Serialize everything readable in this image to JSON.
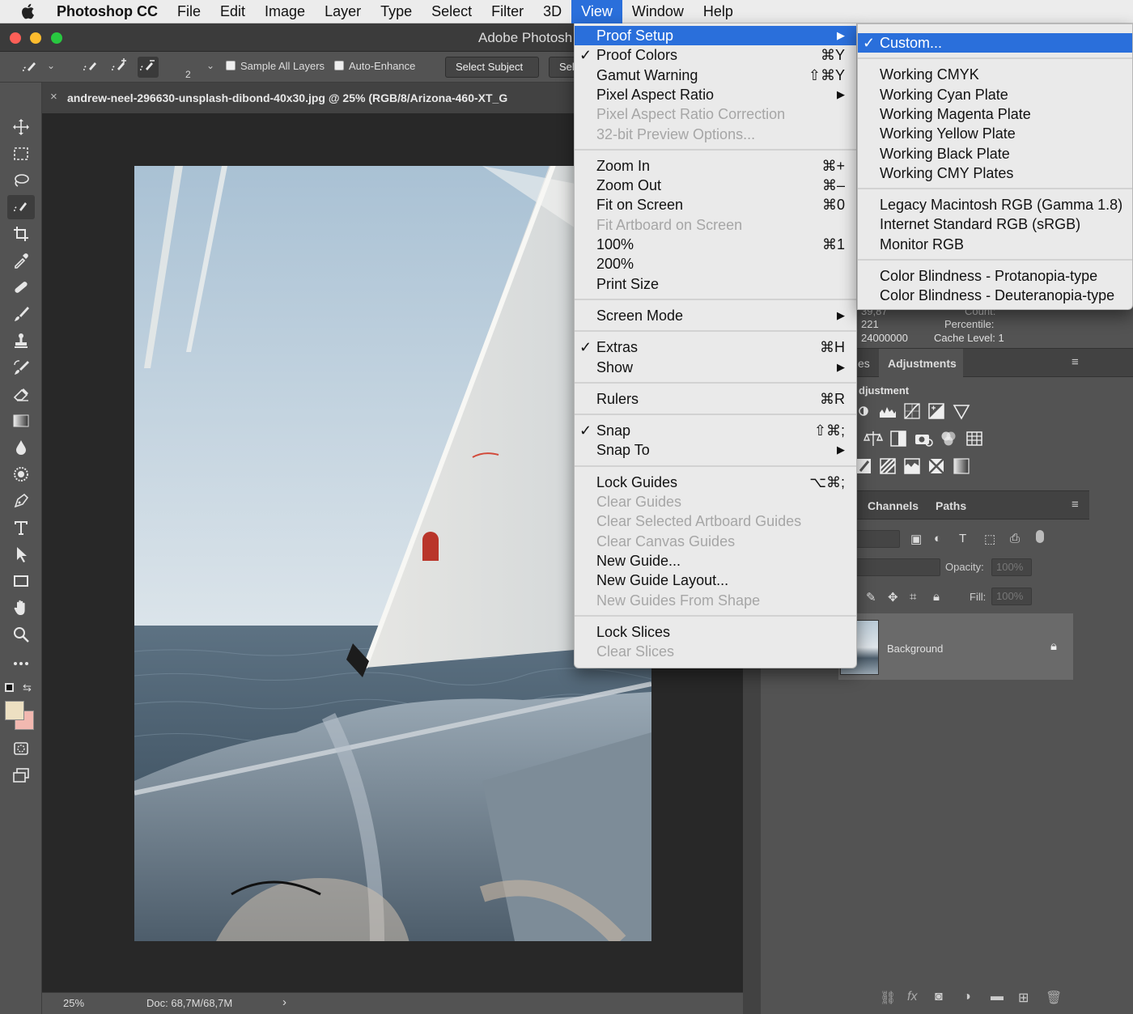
{
  "menubar": {
    "app_name": "Photoshop CC",
    "items": [
      "File",
      "Edit",
      "Image",
      "Layer",
      "Type",
      "Select",
      "Filter",
      "3D",
      "View",
      "Window",
      "Help"
    ],
    "active_item": "View"
  },
  "window": {
    "title": "Adobe Photosh",
    "lights": [
      "#fe5f57",
      "#febc2e",
      "#28c840"
    ]
  },
  "options_bar": {
    "brush_size": "2",
    "sample_all_layers": "Sample All Layers",
    "auto_enhance": "Auto-Enhance",
    "select_subject": "Select Subject",
    "select_and_mask_partial": "Sel"
  },
  "document": {
    "tab_close": "×",
    "tab_title": "andrew-neel-296630-unsplash-dibond-40x30.jpg @ 25% (RGB/8/Arizona-460-XT_G"
  },
  "status": {
    "zoom": "25%",
    "doc_size": "Doc: 68,7M/68,7M",
    "arrow": "›"
  },
  "histogram_info": {
    "col1": [
      "39,87",
      "221",
      "24000000"
    ],
    "col2": [
      "Count:",
      "Percentile:",
      "Cache Level:  1"
    ]
  },
  "adjustments": {
    "tab_prev_partial": "es",
    "tab_active": "Adjustments",
    "header_partial": "djustment"
  },
  "layers": {
    "tabs": [
      "Channels",
      "Paths"
    ],
    "opacity_label": "Opacity:",
    "opacity_value": "100%",
    "fill_label": "Fill:",
    "fill_value": "100%",
    "layer_name": "Background"
  },
  "view_menu": {
    "items": [
      {
        "label": "Proof Setup",
        "arrow": "▶",
        "highlight": true
      },
      {
        "label": "Proof Colors",
        "check": "✓",
        "shortcut": "⌘Y"
      },
      {
        "label": "Gamut Warning",
        "shortcut": "⇧⌘Y"
      },
      {
        "label": "Pixel Aspect Ratio",
        "arrow": "▶"
      },
      {
        "label": "Pixel Aspect Ratio Correction",
        "disabled": true
      },
      {
        "label": "32-bit Preview Options...",
        "disabled": true
      },
      {
        "sep": true
      },
      {
        "label": "Zoom In",
        "shortcut": "⌘+"
      },
      {
        "label": "Zoom Out",
        "shortcut": "⌘–"
      },
      {
        "label": "Fit on Screen",
        "shortcut": "⌘0"
      },
      {
        "label": "Fit Artboard on Screen",
        "disabled": true
      },
      {
        "label": "100%",
        "shortcut": "⌘1"
      },
      {
        "label": "200%"
      },
      {
        "label": "Print Size"
      },
      {
        "sep": true
      },
      {
        "label": "Screen Mode",
        "arrow": "▶"
      },
      {
        "sep": true
      },
      {
        "label": "Extras",
        "check": "✓",
        "shortcut": "⌘H"
      },
      {
        "label": "Show",
        "arrow": "▶"
      },
      {
        "sep": true
      },
      {
        "label": "Rulers",
        "shortcut": "⌘R"
      },
      {
        "sep": true
      },
      {
        "label": "Snap",
        "check": "✓",
        "shortcut": "⇧⌘;"
      },
      {
        "label": "Snap To",
        "arrow": "▶"
      },
      {
        "sep": true
      },
      {
        "label": "Lock Guides",
        "shortcut": "⌥⌘;"
      },
      {
        "label": "Clear Guides",
        "disabled": true
      },
      {
        "label": "Clear Selected Artboard Guides",
        "disabled": true
      },
      {
        "label": "Clear Canvas Guides",
        "disabled": true
      },
      {
        "label": "New Guide..."
      },
      {
        "label": "New Guide Layout..."
      },
      {
        "label": "New Guides From Shape",
        "disabled": true
      },
      {
        "sep": true
      },
      {
        "label": "Lock Slices"
      },
      {
        "label": "Clear Slices",
        "disabled": true
      }
    ]
  },
  "proof_setup_submenu": {
    "items": [
      {
        "label": "Custom...",
        "check": "✓",
        "highlight": true
      },
      {
        "sep": true
      },
      {
        "label": "Working CMYK"
      },
      {
        "label": "Working Cyan Plate"
      },
      {
        "label": "Working Magenta Plate"
      },
      {
        "label": "Working Yellow Plate"
      },
      {
        "label": "Working Black Plate"
      },
      {
        "label": "Working CMY Plates"
      },
      {
        "sep": true
      },
      {
        "label": "Legacy Macintosh RGB (Gamma 1.8)"
      },
      {
        "label": "Internet Standard RGB (sRGB)"
      },
      {
        "label": "Monitor RGB"
      },
      {
        "sep": true
      },
      {
        "label": "Color Blindness - Protanopia-type"
      },
      {
        "label": "Color Blindness - Deuteranopia-type"
      }
    ]
  },
  "colors": {
    "menu_highlight": "#2a6fdb",
    "foreground_swatch": "#ede0c2",
    "background_swatch": "#f2b8b0"
  },
  "tools": [
    "move-icon",
    "marquee-icon",
    "lasso-icon",
    "quick-selection-icon",
    "crop-icon",
    "eyedropper-icon",
    "healing-icon",
    "brush-icon",
    "stamp-icon",
    "history-brush-icon",
    "eraser-icon",
    "gradient-icon",
    "blur-icon",
    "dodge-icon",
    "pen-icon",
    "type-icon",
    "path-selection-icon",
    "rectangle-icon",
    "hand-icon",
    "zoom-icon",
    "more-icon"
  ]
}
